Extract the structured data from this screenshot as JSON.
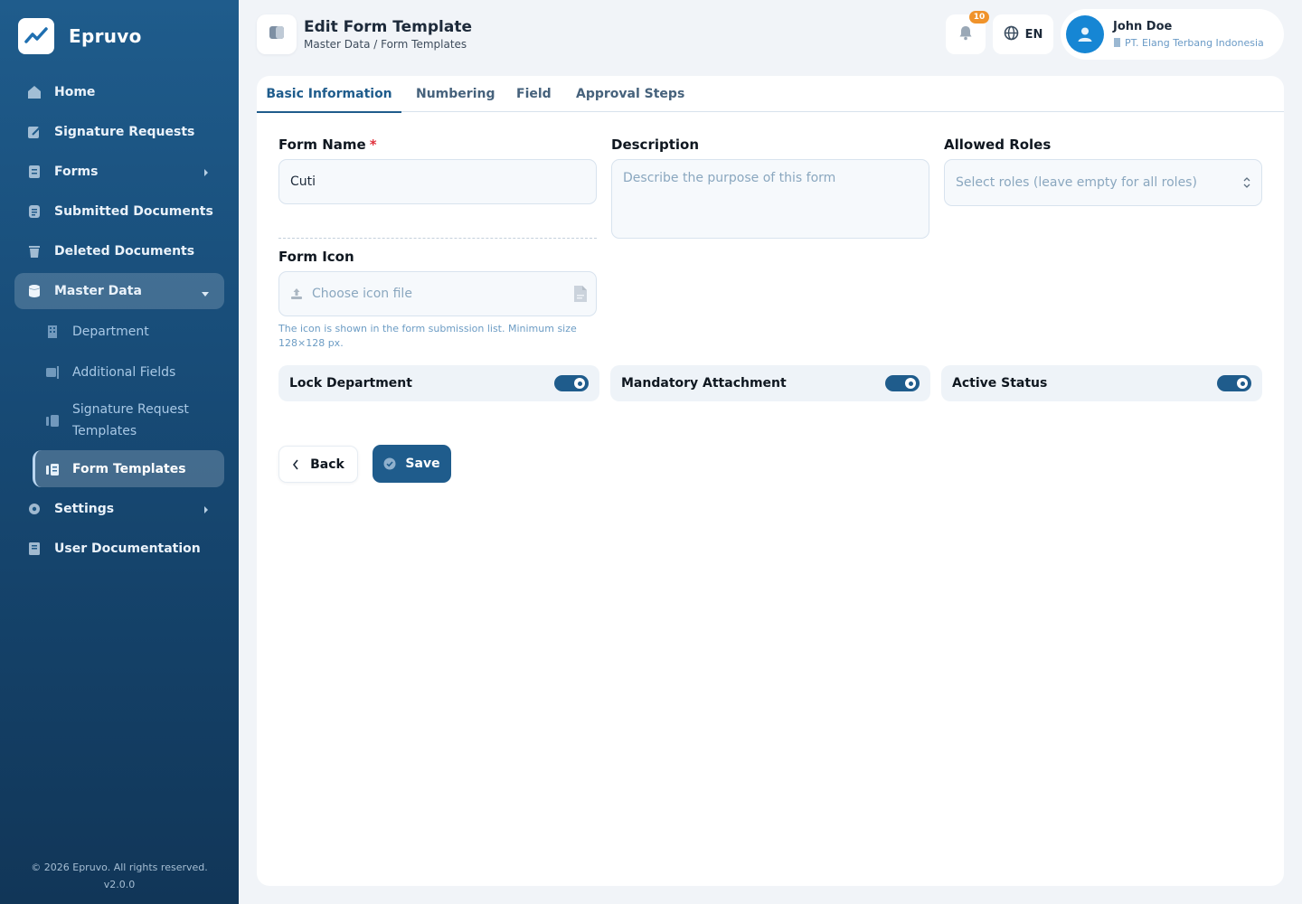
{
  "brand": {
    "name": "Epruvo",
    "logo_icon": "chart-line-icon"
  },
  "sidebar": {
    "items": [
      {
        "label": "Home",
        "icon": "home-icon"
      },
      {
        "label": "Signature Requests",
        "icon": "signature-icon"
      },
      {
        "label": "Forms",
        "icon": "forms-icon",
        "has_submenu": true
      },
      {
        "label": "Submitted Documents",
        "icon": "document-icon"
      },
      {
        "label": "Deleted Documents",
        "icon": "trash-icon"
      },
      {
        "label": "Master Data",
        "icon": "database-icon",
        "expanded": true,
        "active": true
      },
      {
        "label": "Settings",
        "icon": "gear-icon",
        "has_submenu": true
      },
      {
        "label": "User Documentation",
        "icon": "book-icon"
      }
    ],
    "master_data_children": [
      {
        "label": "Department",
        "icon": "building-icon"
      },
      {
        "label": "Additional Fields",
        "icon": "fields-icon"
      },
      {
        "label": "Signature Request Templates",
        "icon": "template-icon"
      },
      {
        "label": "Form Templates",
        "icon": "template-icon",
        "active": true
      }
    ],
    "footer": {
      "copyright": "© 2026 Epruvo. All rights reserved.",
      "version": "v2.0.0"
    }
  },
  "header": {
    "title": "Edit Form Template",
    "breadcrumb": "Master Data / Form Templates",
    "notifications_count": "10",
    "language": "EN",
    "user": {
      "name": "John Doe",
      "company": "PT. Elang Terbang Indonesia"
    }
  },
  "tabs": [
    {
      "label": "Basic Information",
      "active": true
    },
    {
      "label": "Numbering"
    },
    {
      "label": "Field"
    },
    {
      "label": "Approval Steps"
    }
  ],
  "form": {
    "form_name": {
      "label": "Form Name",
      "required_marker": "*",
      "value": "Cuti"
    },
    "description": {
      "label": "Description",
      "placeholder": "Describe the purpose of this form"
    },
    "allowed_roles": {
      "label": "Allowed Roles",
      "placeholder": "Select roles (leave empty for all roles)"
    },
    "form_icon": {
      "label": "Form Icon",
      "placeholder": "Choose icon file",
      "hint": "The icon is shown in the form submission list. Minimum size 128×128 px."
    },
    "toggles": [
      {
        "label": "Lock Department",
        "on": true
      },
      {
        "label": "Mandatory Attachment",
        "on": true
      },
      {
        "label": "Active Status",
        "on": true
      }
    ]
  },
  "actions": {
    "back_label": "Back",
    "save_label": "Save"
  },
  "colors": {
    "primary": "#1f5c8c",
    "badge": "#f0932b",
    "required": "#e0313c",
    "avatar": "#1686d4"
  }
}
